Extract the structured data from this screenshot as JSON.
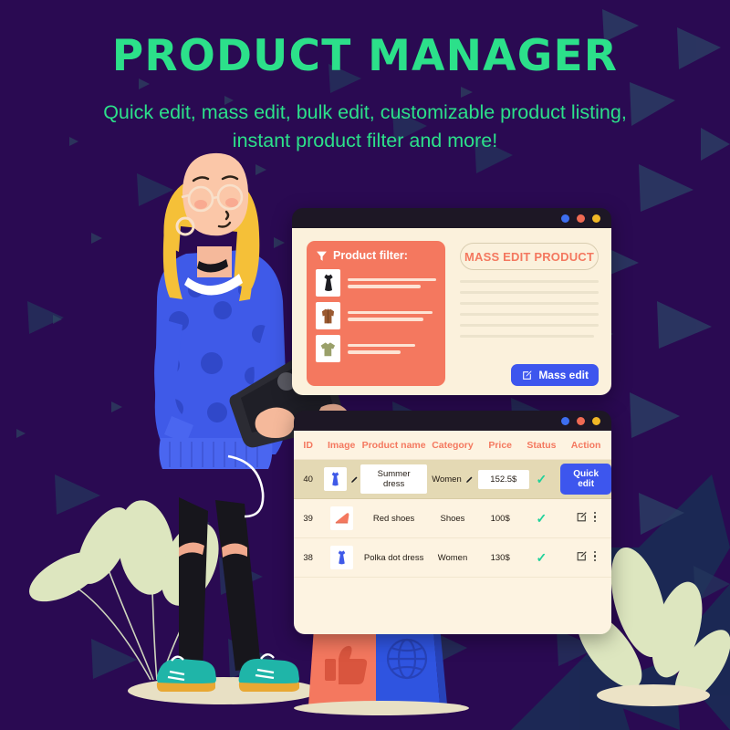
{
  "hero": {
    "title": "PRODUCT MANAGER",
    "subtitle_line1": "Quick edit, mass edit, bulk edit, customizable product listing,",
    "subtitle_line2": "instant product filter and more!",
    "title_color": "#2ce08a",
    "background_color": "#2a0a52"
  },
  "mass_edit_window": {
    "titlebar": {
      "dots": [
        "blue",
        "red",
        "yellow"
      ],
      "dot_colors": {
        "blue": "#3d6ef0",
        "red": "#ef6a53",
        "yellow": "#f0b726"
      }
    },
    "filter_card": {
      "icon": "funnel-icon",
      "title": "Product filter:",
      "background_color": "#f4785f",
      "items": [
        {
          "thumb": "black-dress-icon"
        },
        {
          "thumb": "brown-jacket-icon"
        },
        {
          "thumb": "olive-tshirt-icon"
        }
      ]
    },
    "mass_edit_pill_label": "MASS EDIT PRODUCT",
    "placeholder_line_count": 6,
    "mass_edit_button": {
      "label": "Mass edit",
      "icon": "edit-icon",
      "color": "#3d56ee"
    }
  },
  "product_table_window": {
    "titlebar": {
      "dots": [
        "blue",
        "red",
        "yellow"
      ]
    },
    "columns": [
      "ID",
      "Image",
      "Product name",
      "Category",
      "Price",
      "Status",
      "Action"
    ],
    "header_color": "#f4785f",
    "rows": [
      {
        "id": "40",
        "image": "blue-dress-icon",
        "product_name": "Summer dress",
        "category": "Women",
        "price": "152.5$",
        "status": "active",
        "action_label": "Quick edit",
        "editing": true
      },
      {
        "id": "39",
        "image": "red-shoe-icon",
        "product_name": "Red shoes",
        "category": "Shoes",
        "price": "100$",
        "status": "active",
        "editing": false
      },
      {
        "id": "38",
        "image": "blue-dress-icon",
        "product_name": "Polka dot dress",
        "category": "Women",
        "price": "130$",
        "status": "active",
        "editing": false
      }
    ]
  },
  "illustration": {
    "character": "woman-with-laptop",
    "bags": [
      {
        "name": "orange-shopping-bag",
        "icon": "thumbs-up-icon",
        "color": "#f4785f"
      },
      {
        "name": "blue-shopping-bag",
        "icon": "globe-icon",
        "color": "#2f54e0"
      }
    ],
    "plants": [
      "left-plant",
      "right-plant"
    ]
  }
}
